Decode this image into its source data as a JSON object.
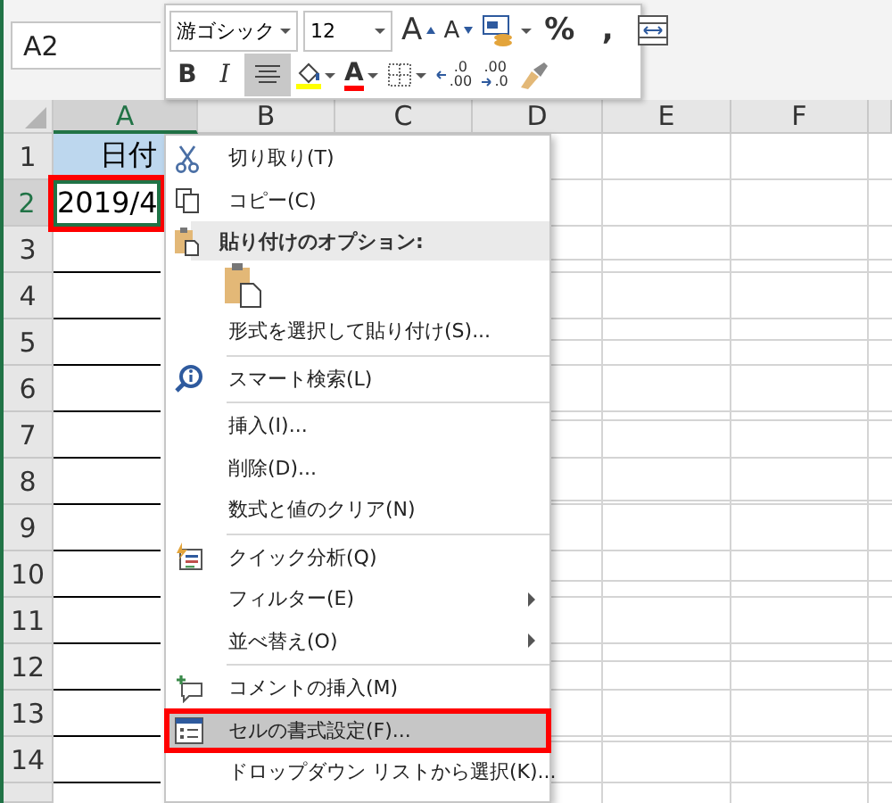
{
  "name_box": {
    "value": "A2"
  },
  "mini_toolbar": {
    "font": "游ゴシック",
    "size": "12",
    "buttons": [
      {
        "kind": "grow",
        "label": "A",
        "selected": false
      },
      {
        "kind": "shrink",
        "label": "A",
        "selected": false
      },
      {
        "kind": "format",
        "selected": false
      },
      {
        "kind": "text",
        "label": "%",
        "selected": false
      },
      {
        "kind": "text",
        "label": ",",
        "selected": false
      },
      {
        "kind": "wrap",
        "selected": false
      },
      {
        "kind": "bold",
        "label": "B",
        "selected": false
      },
      {
        "kind": "italic",
        "label": "I",
        "selected": false
      },
      {
        "kind": "align",
        "selected": true
      },
      {
        "kind": "fill",
        "color": "#ffff00",
        "selected": false
      },
      {
        "kind": "fontcolor",
        "label": "A",
        "color": "#ff0000",
        "selected": false
      },
      {
        "kind": "border",
        "selected": false
      },
      {
        "kind": "incdec",
        "top": ".0",
        "bottom": ".00",
        "selected": false
      },
      {
        "kind": "decdec",
        "top": ".00",
        "bottom": ".0",
        "selected": false
      },
      {
        "kind": "painter",
        "selected": false
      }
    ]
  },
  "columns": [
    {
      "label": "A",
      "selected": true
    },
    {
      "label": "B",
      "selected": false
    },
    {
      "label": "C",
      "selected": false
    },
    {
      "label": "D",
      "selected": false
    },
    {
      "label": "E",
      "selected": false
    },
    {
      "label": "F",
      "selected": false
    }
  ],
  "rows": [
    {
      "label": "1",
      "selected": false,
      "cell_a": {
        "value": "日付",
        "color": "#bdd7ee",
        "selected": false,
        "highlighted": false
      }
    },
    {
      "label": "2",
      "selected": true,
      "cell_a": {
        "value": "2019/4",
        "selected": true,
        "highlighted": true
      }
    },
    {
      "label": "3",
      "selected": false
    },
    {
      "label": "4",
      "selected": false
    },
    {
      "label": "5",
      "selected": false
    },
    {
      "label": "6",
      "selected": false
    },
    {
      "label": "7",
      "selected": false
    },
    {
      "label": "8",
      "selected": false
    },
    {
      "label": "9",
      "selected": false
    },
    {
      "label": "10",
      "selected": false
    },
    {
      "label": "11",
      "selected": false
    },
    {
      "label": "12",
      "selected": false
    },
    {
      "label": "13",
      "selected": false
    },
    {
      "label": "14",
      "selected": false
    }
  ],
  "context_menu": [
    {
      "kind": "item",
      "label": "切り取り(T)",
      "selected": false,
      "highlighted": false,
      "submenu": false
    },
    {
      "kind": "item",
      "label": "コピー(C)",
      "selected": false,
      "highlighted": false,
      "submenu": false
    },
    {
      "kind": "header",
      "label": "貼り付けのオプション:"
    },
    {
      "kind": "paste_option"
    },
    {
      "kind": "item",
      "label": "形式を選択して貼り付け(S)...",
      "selected": false,
      "highlighted": false,
      "submenu": false
    },
    {
      "kind": "separator"
    },
    {
      "kind": "item",
      "label": "スマート検索(L)",
      "selected": false,
      "highlighted": false,
      "submenu": false
    },
    {
      "kind": "separator"
    },
    {
      "kind": "item",
      "label": "挿入(I)...",
      "selected": false,
      "highlighted": false,
      "submenu": false
    },
    {
      "kind": "item",
      "label": "削除(D)...",
      "selected": false,
      "highlighted": false,
      "submenu": false
    },
    {
      "kind": "item",
      "label": "数式と値のクリア(N)",
      "selected": false,
      "highlighted": false,
      "submenu": false
    },
    {
      "kind": "separator"
    },
    {
      "kind": "item",
      "label": "クイック分析(Q)",
      "selected": false,
      "highlighted": false,
      "submenu": false
    },
    {
      "kind": "item",
      "label": "フィルター(E)",
      "selected": false,
      "highlighted": false,
      "submenu": true
    },
    {
      "kind": "item",
      "label": "並べ替え(O)",
      "selected": false,
      "highlighted": false,
      "submenu": true
    },
    {
      "kind": "separator"
    },
    {
      "kind": "item",
      "label": "コメントの挿入(M)",
      "selected": false,
      "highlighted": false,
      "submenu": false
    },
    {
      "kind": "item",
      "label": "セルの書式設定(F)...",
      "selected": true,
      "highlighted": true,
      "submenu": false
    },
    {
      "kind": "item",
      "label": "ドロップダウン リストから選択(K)...",
      "selected": false,
      "highlighted": false,
      "submenu": false
    }
  ]
}
